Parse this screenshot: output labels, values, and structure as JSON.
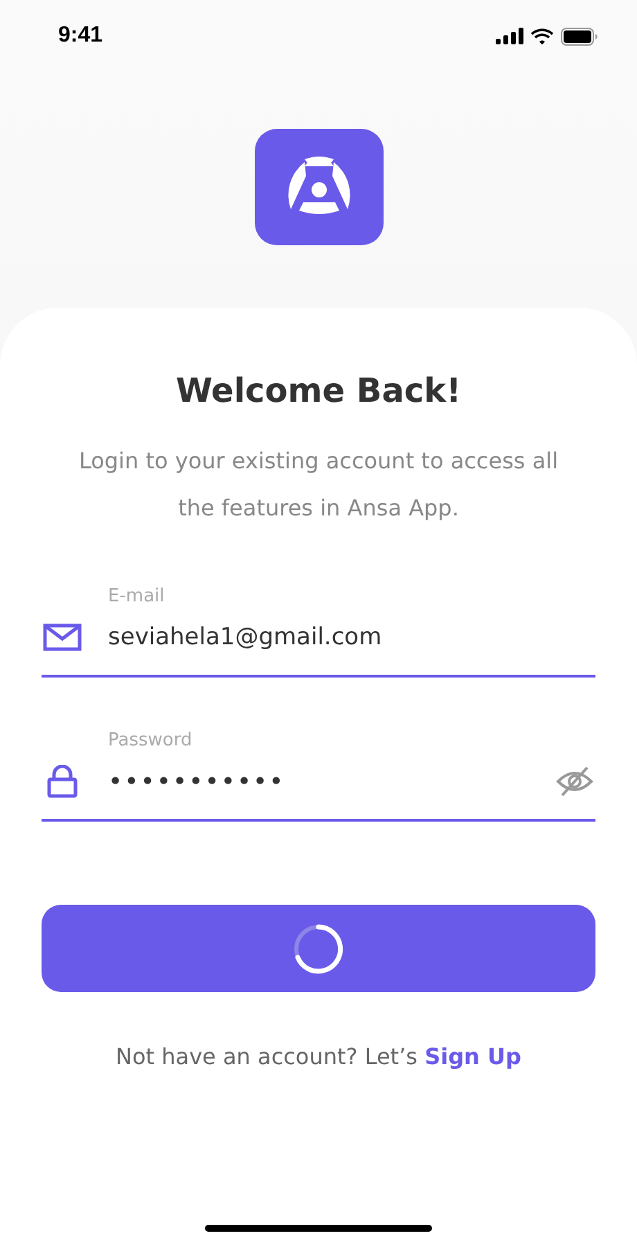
{
  "status_bar": {
    "time": "9:41"
  },
  "title": "Welcome Back!",
  "subtitle": "Login to your existing account to access all the features in Ansa App.",
  "fields": [
    {
      "kind": "email",
      "label": "E-mail",
      "value": "seviahela1@gmail.com"
    },
    {
      "kind": "password",
      "label": "Password",
      "value": "•••••••••••",
      "visible": false
    }
  ],
  "login_button": {
    "loading": true
  },
  "signup": {
    "text": "Not have an account? Let’s",
    "link": "Sign Up"
  }
}
